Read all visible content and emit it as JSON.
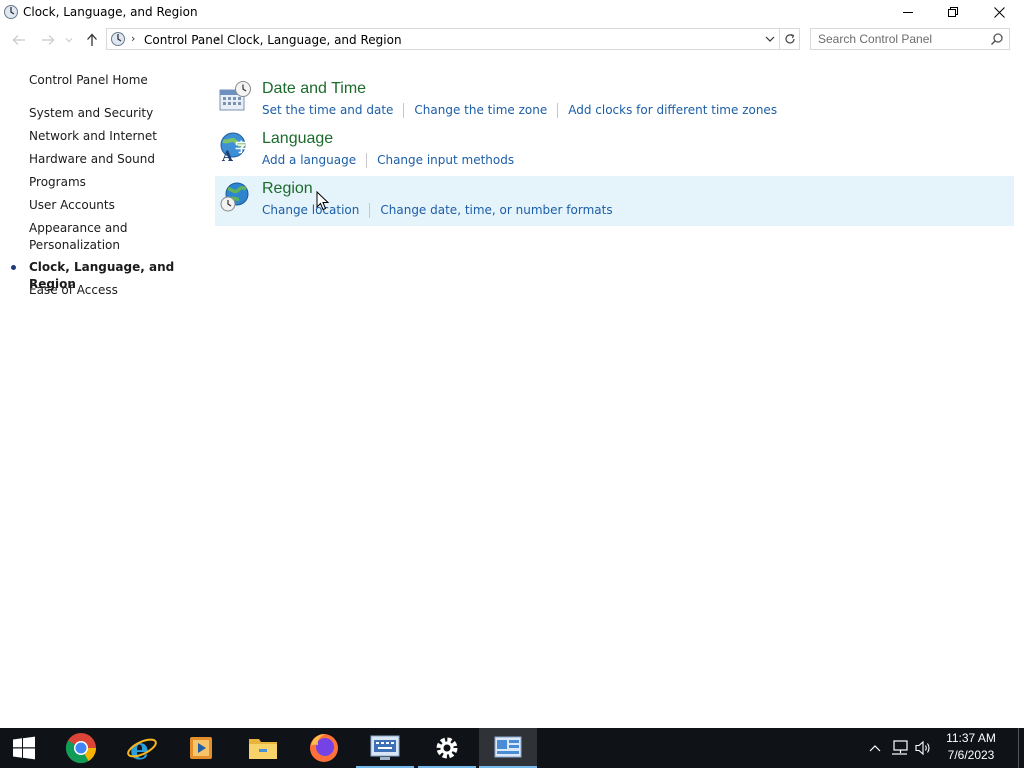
{
  "window": {
    "title": "Clock, Language, and Region"
  },
  "address": {
    "breadcrumb": [
      "Control Panel",
      "Clock, Language, and Region"
    ],
    "search_placeholder": "Search Control Panel"
  },
  "leftpane": {
    "home": "Control Panel Home",
    "items": [
      "System and Security",
      "Network and Internet",
      "Hardware and Sound",
      "Programs",
      "User Accounts",
      "Appearance and Personalization",
      "Clock, Language, and Region",
      "Ease of Access"
    ],
    "current_index": 6
  },
  "categories": [
    {
      "title": "Date and Time",
      "icon": "date-time-icon",
      "links": [
        "Set the time and date",
        "Change the time zone",
        "Add clocks for different time zones"
      ]
    },
    {
      "title": "Language",
      "icon": "language-icon",
      "links": [
        "Add a language",
        "Change input methods"
      ]
    },
    {
      "title": "Region",
      "icon": "region-globe-icon",
      "links": [
        "Change location",
        "Change date, time, or number formats"
      ]
    }
  ],
  "taskbar": {
    "apps": [
      "start-icon",
      "chrome-icon",
      "internet-explorer-icon",
      "media-player-icon",
      "file-explorer-icon",
      "firefox-icon",
      "on-screen-keyboard-icon",
      "settings-gear-icon",
      "control-panel-icon"
    ],
    "clock_time": "11:37 AM",
    "clock_date": "7/6/2023"
  },
  "colors": {
    "category_title": "#1c6b2c",
    "link": "#1c5ea8",
    "hover_bg": "#e5f3fb",
    "taskbar": "#0f1216"
  }
}
